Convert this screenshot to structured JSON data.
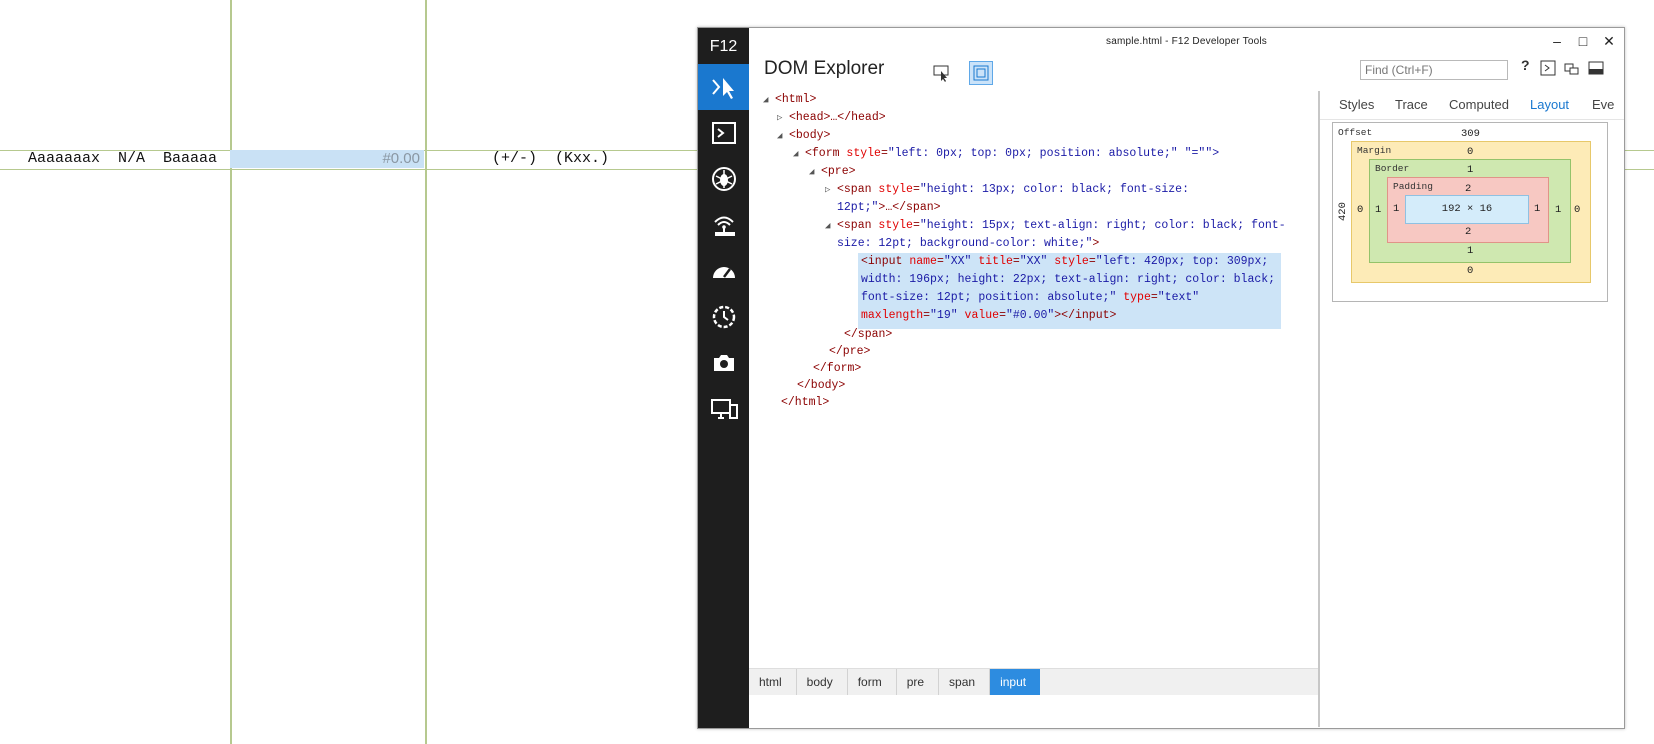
{
  "page": {
    "row_text_left": "Aaaaaaax  N/A  Baaaaa",
    "input_value": "#0.00",
    "row_text_right": "(+/-)  (Kxx.)"
  },
  "devtools": {
    "logo": "F12",
    "window_title": "sample.html - F12 Developer Tools",
    "tool_title": "DOM Explorer",
    "find_placeholder": "Find (Ctrl+F)",
    "help": "?",
    "rail_items": [
      "dom-explorer-icon",
      "console-icon",
      "debugger-icon",
      "network-icon",
      "performance-icon",
      "memory-icon",
      "emulation-icon",
      "display-icon"
    ],
    "tabs": [
      "Styles",
      "Trace",
      "Computed",
      "Layout",
      "Eve"
    ],
    "active_tab": "Layout",
    "breadcrumb": [
      "html",
      "body",
      "form",
      "pre",
      "span",
      "input"
    ],
    "box_model": {
      "labels": {
        "offset": "Offset",
        "margin": "Margin",
        "border": "Border",
        "padding": "Padding"
      },
      "offset_top": "309",
      "offset_left": "420",
      "margin": {
        "top": "0",
        "right": "0",
        "bottom": "0",
        "left": "0"
      },
      "border": {
        "top": "1",
        "right": "1",
        "bottom": "1",
        "left": "1"
      },
      "padding": {
        "top": "2",
        "right": "1",
        "bottom": "2",
        "left": "1"
      },
      "content": "192 × 16"
    }
  },
  "dom_tree": {
    "html_open": "<html>",
    "head": "<head>…</head>",
    "body_open": "<body>",
    "form_tag": "<form",
    "form_attr1": "style",
    "form_val1": "\"left: 0px; top: 0px; position: absolute;\"",
    "form_attr2": "\"=\"\">",
    "pre_open": "<pre>",
    "span1_tag": "<span",
    "span1_attr": "style",
    "span1_val1": "\"height: 13px; color: black; font-size:",
    "span1_val2": "12pt;\"",
    "span1_close": ">…</span>",
    "span2_tag": "<span",
    "span2_attr": "style",
    "span2_val1": "\"height: 15px; text-align: right; color: black; font-",
    "span2_val2": "size: 12pt; background-color: white;\"",
    "span2_end": ">",
    "input_l1_tag": "<input",
    "input_l1_a1": "name",
    "input_l1_v1": "\"XX\"",
    "input_l1_a2": "title",
    "input_l1_v2": "\"XX\"",
    "input_l1_a3": "style",
    "input_l1_v3": "\"left: 420px; top: 309px;",
    "input_l2": "width: 196px; height: 22px; text-align: right; color: black;",
    "input_l3_v": "font-size: 12pt; position: absolute;\"",
    "input_l3_a": "type",
    "input_l3_v2": "\"text\"",
    "input_l4_a1": "maxlength",
    "input_l4_v1": "\"19\"",
    "input_l4_a2": "value",
    "input_l4_v2": "\"#0.00\"",
    "input_l4_end": "></input>",
    "span_close": "</span>",
    "pre_close": "</pre>",
    "form_close": "</form>",
    "body_close": "</body>",
    "html_close": "</html>"
  }
}
